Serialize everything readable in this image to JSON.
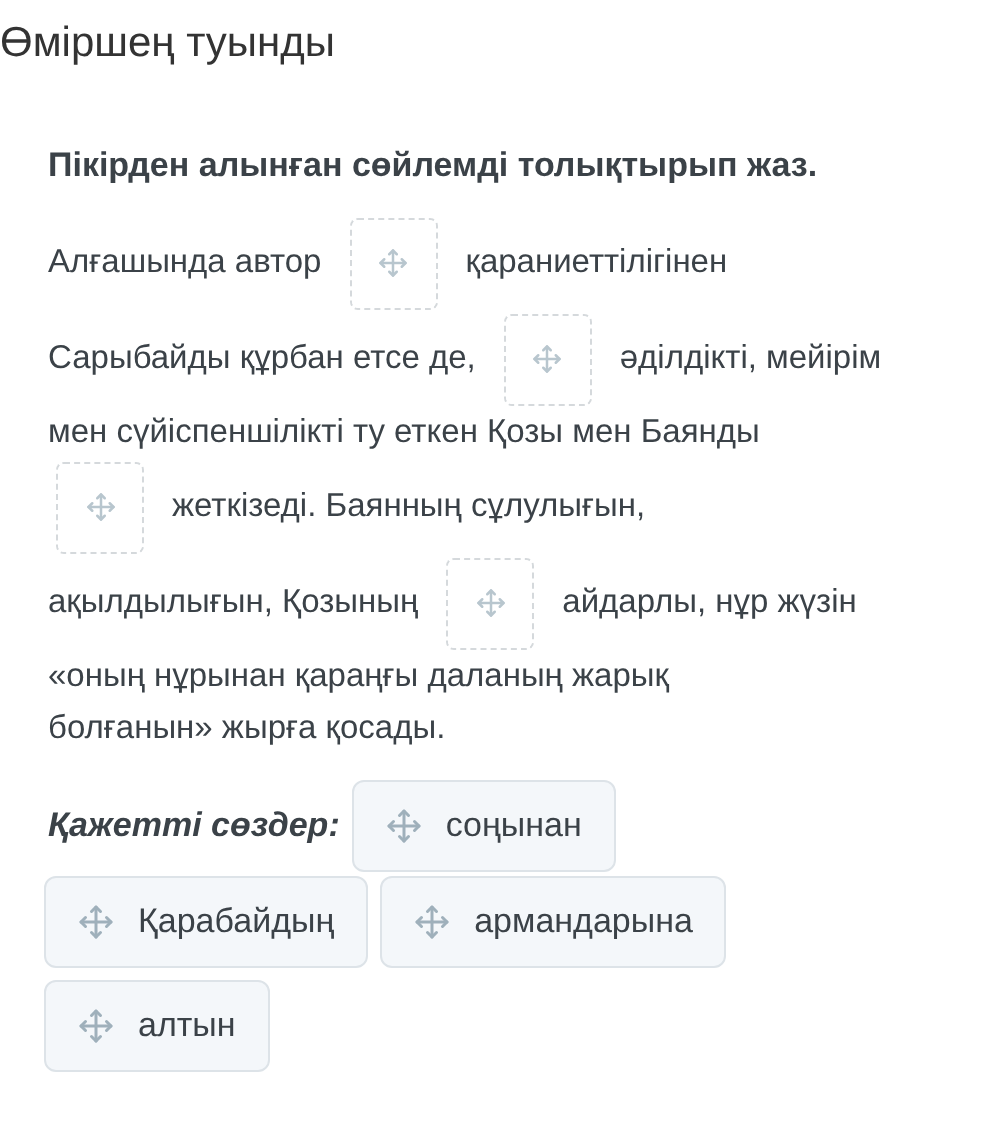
{
  "title": "Өміршең туынды",
  "instruction": "Пікірден алынған сөйлемді толықтырып жаз.",
  "sentence_lines": [
    [
      {
        "kind": "text",
        "text": "Алғашында автор"
      },
      {
        "kind": "blank"
      },
      {
        "kind": "text",
        "text": "қараниеттілігінен"
      }
    ],
    [
      {
        "kind": "text",
        "text": "Сарыбайды құрбан етсе де,"
      },
      {
        "kind": "blank"
      },
      {
        "kind": "text",
        "text": "әділдікті, мейірім"
      }
    ],
    [
      {
        "kind": "text",
        "text": "мен сүйіспеншілікті ту еткен Қозы мен Баянды"
      }
    ],
    [
      {
        "kind": "blank"
      },
      {
        "kind": "text",
        "text": "жеткізеді. Баянның сұлулығын,"
      }
    ],
    [
      {
        "kind": "text",
        "text": "ақылдылығын, Қозының"
      },
      {
        "kind": "blank"
      },
      {
        "kind": "text",
        "text": "айдарлы, нұр жүзін"
      }
    ],
    [
      {
        "kind": "text",
        "text": "«оның нұрынан қараңғы даланың жарық"
      }
    ],
    [
      {
        "kind": "text",
        "text": "болғанын» жырға қосады."
      }
    ]
  ],
  "words_label": "Қажетті сөздер:",
  "words": [
    "соңынан",
    "Қарабайдың",
    "армандарына",
    "алтын"
  ]
}
